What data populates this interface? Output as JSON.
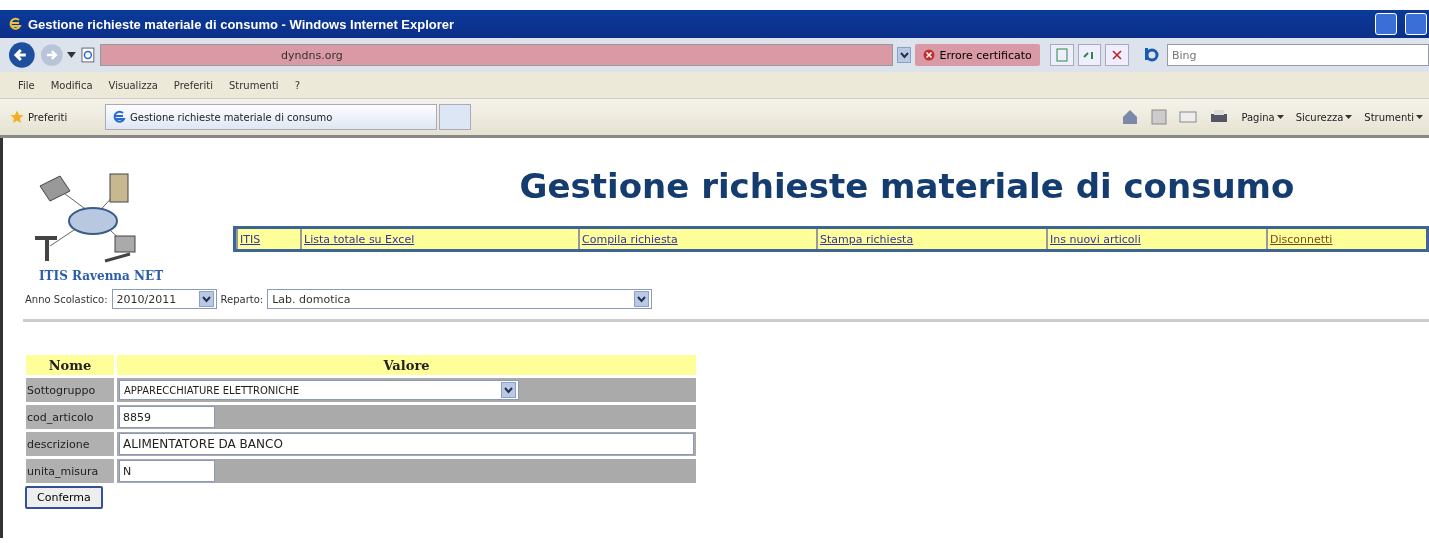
{
  "window": {
    "title": "Gestione richieste materiale di consumo - Windows Internet Explorer"
  },
  "address_bar": {
    "url_host": "dyndns.org",
    "certificate_error": "Errore certificato"
  },
  "search": {
    "placeholder": "Bing"
  },
  "menu": [
    "File",
    "Modifica",
    "Visualizza",
    "Preferiti",
    "Strumenti",
    "?"
  ],
  "favorites": {
    "label": "Preferiti"
  },
  "tabs": [
    {
      "label": "Gestione richieste materiale di consumo",
      "selected": true
    }
  ],
  "command_bar": [
    "Pagina",
    "Sicurezza",
    "Strumenti"
  ],
  "page": {
    "logo_text": "ITIS Ravenna NET",
    "heading": "Gestione richieste materiale di consumo",
    "nav": [
      {
        "label": "ITIS",
        "visited": false
      },
      {
        "label": "Lista totale su Excel",
        "visited": false
      },
      {
        "label": "Compila richiesta",
        "visited": false
      },
      {
        "label": "Stampa richiesta",
        "visited": false
      },
      {
        "label": "Ins nuovi articoli",
        "visited": false
      },
      {
        "label": "Disconnetti",
        "visited": true
      }
    ],
    "filters": [
      {
        "label": "Anno Scolastico:",
        "value": "2010/2011"
      },
      {
        "label": "Reparto:",
        "value": "Lab. domotica"
      }
    ],
    "table": {
      "columns": [
        "Nome",
        "Valore"
      ],
      "rows": [
        {
          "name": "Sottogruppo",
          "kind": "select",
          "value": "APPARECCHIATURE ELETTRONICHE"
        },
        {
          "name": "cod_articolo",
          "kind": "short",
          "value": "8859"
        },
        {
          "name": "descrizione",
          "kind": "wide",
          "value": "ALIMENTATORE DA BANCO"
        },
        {
          "name": "unita_misura",
          "kind": "short",
          "value": "N"
        }
      ]
    },
    "submit": "Conferma"
  }
}
